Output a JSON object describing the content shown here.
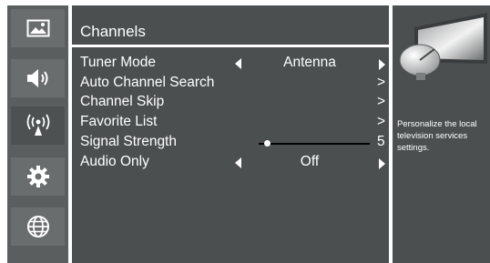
{
  "sidebar": {
    "items": [
      {
        "icon": "picture-icon",
        "active": false
      },
      {
        "icon": "speaker-icon",
        "active": false
      },
      {
        "icon": "broadcast-icon",
        "active": true
      },
      {
        "icon": "gear-icon",
        "active": false
      },
      {
        "icon": "globe-icon",
        "active": false
      }
    ]
  },
  "panel": {
    "title": "Channels",
    "rows": [
      {
        "label": "Tuner Mode",
        "value": "Antenna"
      },
      {
        "label": "Auto Channel Search",
        "chevron": ">"
      },
      {
        "label": "Channel Skip",
        "chevron": ">"
      },
      {
        "label": "Favorite List",
        "chevron": ">"
      },
      {
        "label": "Signal Strength",
        "level": 5,
        "level_fraction": 0.05
      },
      {
        "label": "Audio Only",
        "value": "Off"
      }
    ]
  },
  "help": {
    "text": "Personalize the local television services settings."
  },
  "colors": {
    "panel_bg": "#4b4f50",
    "rail_bg": "#5b5e5f",
    "text": "#ffffff"
  }
}
